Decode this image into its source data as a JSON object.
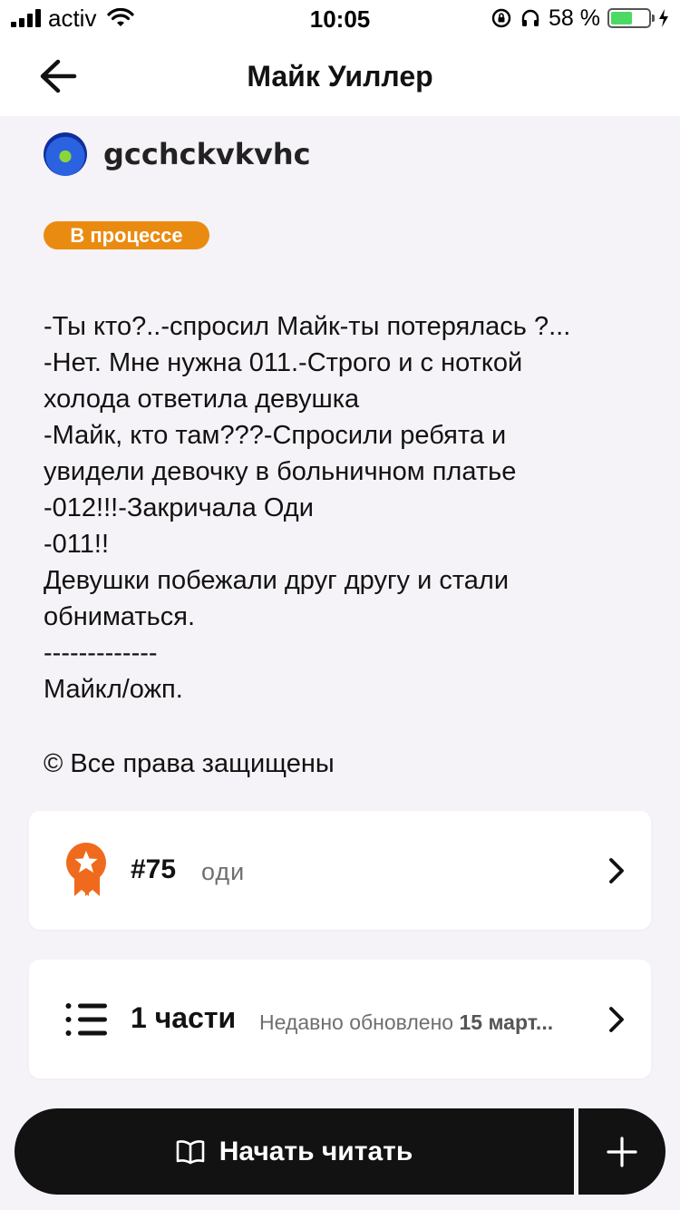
{
  "status_bar": {
    "carrier": "activ",
    "time": "10:05",
    "battery_percent": "58 %",
    "battery_level": 0.58,
    "icons": [
      "signal-icon",
      "wifi-icon",
      "rotation-lock-icon",
      "headphones-icon",
      "battery-icon",
      "charging-icon"
    ]
  },
  "header": {
    "title": "Майк Уиллер"
  },
  "author": {
    "username": "gcchckvkvhc"
  },
  "status_badge": {
    "label": "В процессе",
    "color": "#ea8b11"
  },
  "description": {
    "lines": [
      "-Ты кто?..-спросил Майк-ты потерялась ?...",
      "-Нет. Мне нужна 011.-Строго и с ноткой",
      "холода ответила девушка",
      "-Майк, кто там???-Спросили ребята и",
      "увидели девочку в больничном платье",
      "-012!!!-Закричала Оди",
      "-011!!",
      "Девушки побежали друг другу и стали",
      "обниматься.",
      "-------------",
      "Майкл/ожп."
    ],
    "copyright": "© Все права защищены"
  },
  "ranking_card": {
    "rank": "#75",
    "tag": "оди",
    "accent": "#f06a1d"
  },
  "parts_card": {
    "parts": "1 части",
    "updated_prefix": "Недавно обновлено",
    "updated_date": "15 март..."
  },
  "actions": {
    "start_reading": "Начать читать"
  }
}
